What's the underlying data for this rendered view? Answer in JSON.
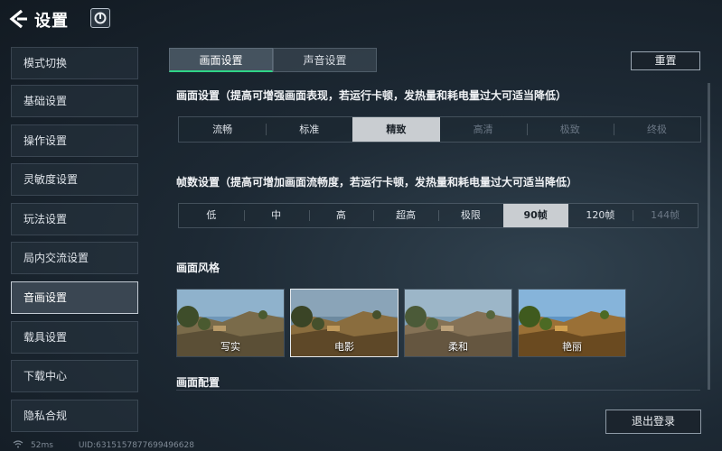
{
  "header": {
    "title": "设置",
    "back_icon": "back-arrow-icon",
    "logo_icon": "game-logo-icon"
  },
  "sidebar": {
    "items": [
      {
        "label": "模式切换"
      },
      {
        "label": "基础设置"
      },
      {
        "label": "操作设置"
      },
      {
        "label": "灵敏度设置"
      },
      {
        "label": "玩法设置"
      },
      {
        "label": "局内交流设置"
      },
      {
        "label": "音画设置",
        "active": true
      },
      {
        "label": "载具设置"
      },
      {
        "label": "下载中心"
      },
      {
        "label": "隐私合规"
      }
    ]
  },
  "tabs": [
    {
      "label": "画面设置",
      "active": true
    },
    {
      "label": "声音设置"
    }
  ],
  "reset_label": "重置",
  "graphics": {
    "title": "画面设置（提高可增强画面表现，若运行卡顿，发热量和耗电量过大可适当降低）",
    "options": [
      "流畅",
      "标准",
      "精致",
      "高清",
      "极致",
      "终极"
    ],
    "selected": "精致",
    "disabled": [
      "高清",
      "极致",
      "终极"
    ]
  },
  "framerate": {
    "title": "帧数设置（提高可增加画面流畅度，若运行卡顿，发热量和耗电量过大可适当降低）",
    "options": [
      "低",
      "中",
      "高",
      "超高",
      "极限",
      "90帧",
      "120帧",
      "144帧"
    ],
    "selected": "90帧",
    "disabled": [
      "144帧"
    ]
  },
  "style": {
    "title": "画面风格",
    "options": [
      {
        "label": "写实"
      },
      {
        "label": "电影",
        "selected": true
      },
      {
        "label": "柔和"
      },
      {
        "label": "艳丽"
      }
    ]
  },
  "config_title": "画面配置",
  "logout_label": "退出登录",
  "footer": {
    "ping": "52ms",
    "uid": "UID:6315157877699496628"
  },
  "colors": {
    "accent": "#2fd487",
    "selected_bg": "#c9cdd1"
  }
}
